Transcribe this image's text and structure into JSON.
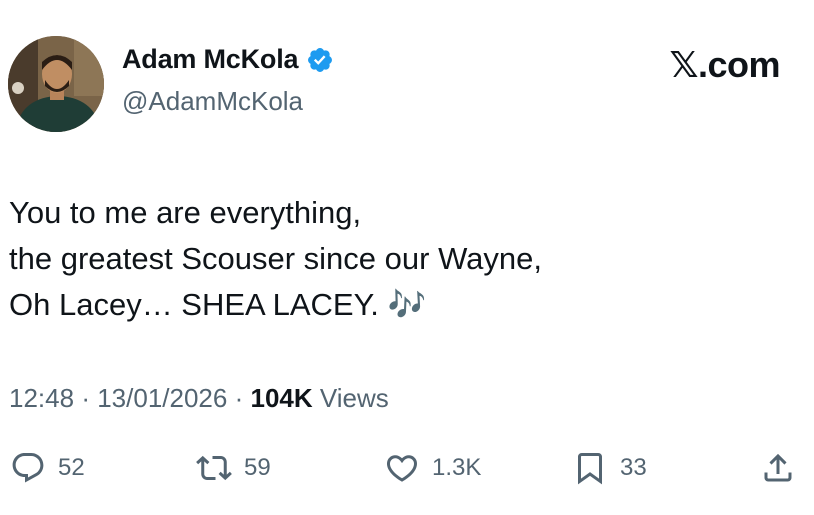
{
  "author": {
    "name": "Adam McKola",
    "handle": "@AdamMcKola",
    "verified_color": "#1d9bf0"
  },
  "brand": {
    "x": "𝕏",
    "suffix": ".com"
  },
  "tweet": {
    "lines": [
      "You to me are everything,",
      "the greatest Scouser since our Wayne,",
      "Oh Lacey… SHEA LACEY. 🎶"
    ]
  },
  "meta": {
    "time": "12:48",
    "separator": "·",
    "date": "13/01/2026",
    "views_count": "104K",
    "views_label": "Views"
  },
  "actions": {
    "replies": "52",
    "reposts": "59",
    "likes": "1.3K",
    "bookmarks": "33",
    "icons": [
      "reply-icon",
      "repost-icon",
      "like-icon",
      "bookmark-icon",
      "share-icon"
    ]
  },
  "colors": {
    "text": "#0f1419",
    "secondary": "#536471"
  }
}
